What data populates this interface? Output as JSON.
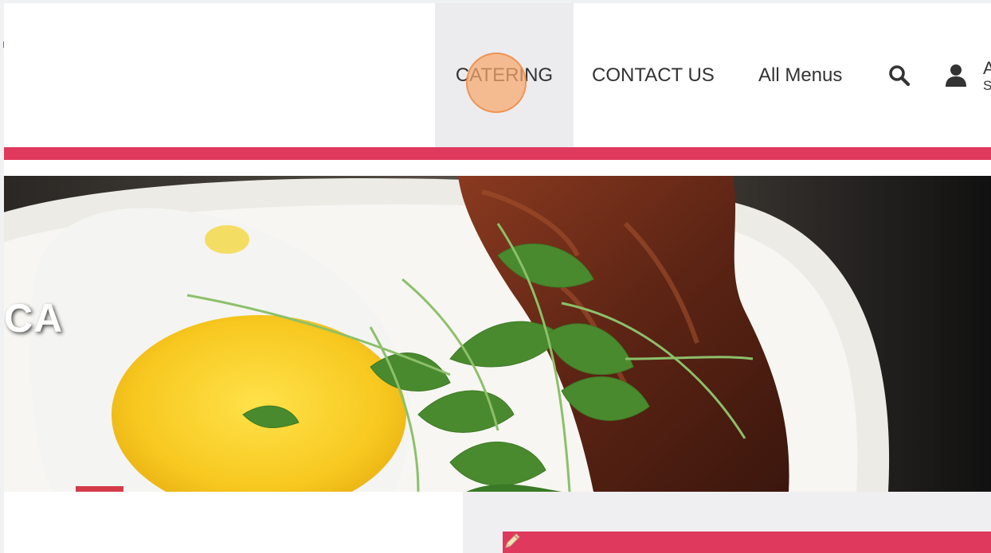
{
  "nav": {
    "catering": "CATERING",
    "contact": "CONTACT US",
    "menus": "All Menus",
    "search_icon": "search-icon",
    "account_icon": "user-icon",
    "account_line1": "A",
    "account_line2": "S"
  },
  "hero": {
    "text": "CA"
  },
  "colors": {
    "accent": "#e0395e",
    "nav_hover": "#ececee",
    "click_marker": "#f6a86e"
  }
}
